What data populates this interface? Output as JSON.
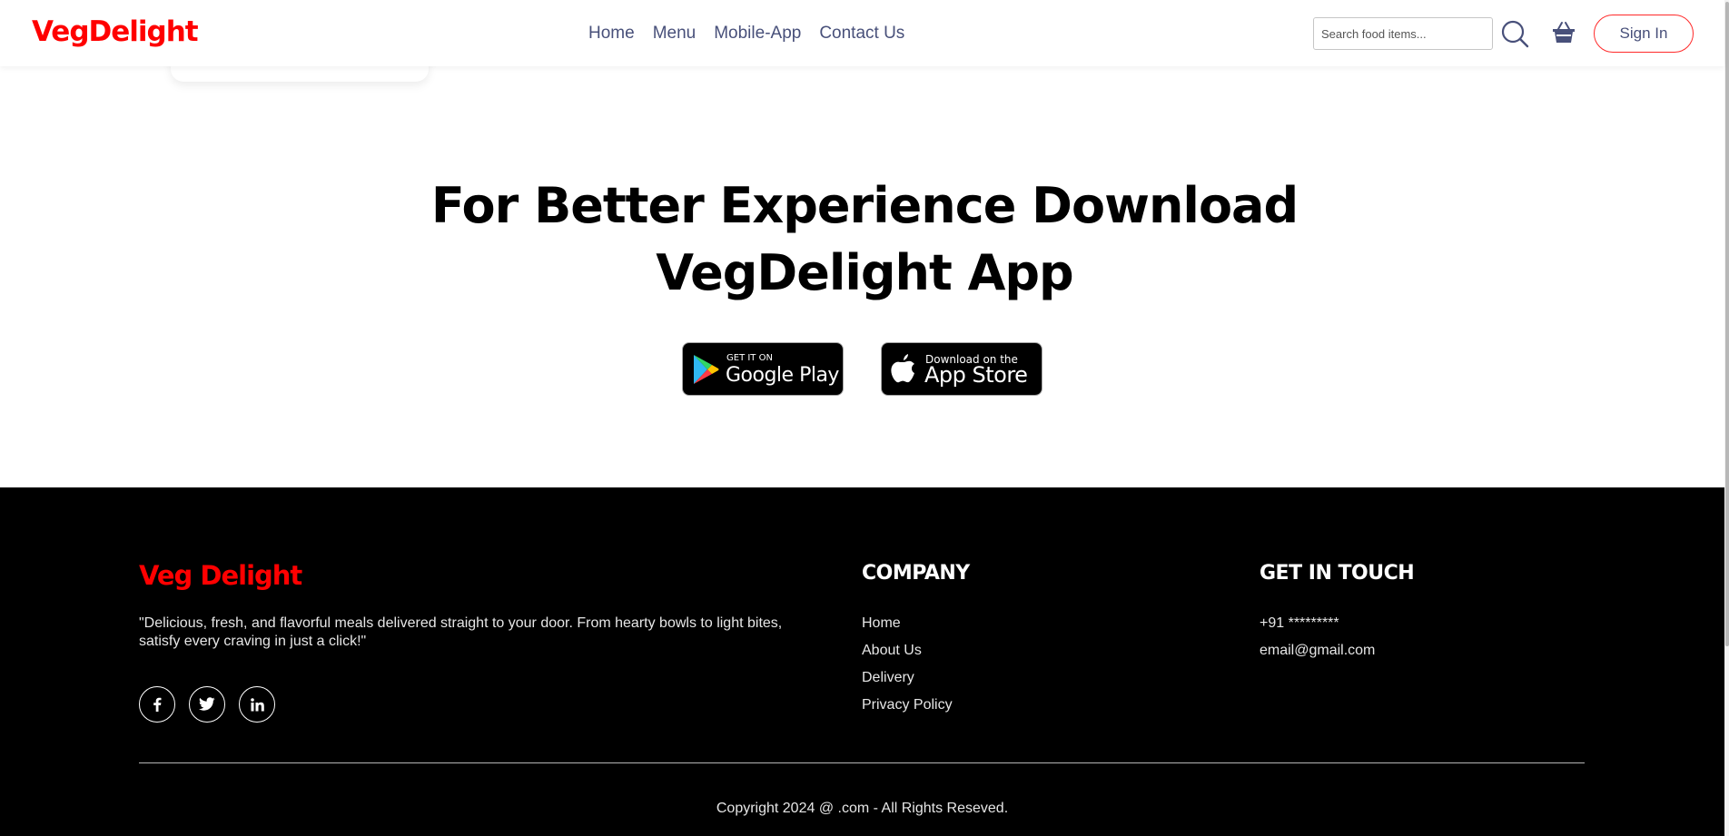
{
  "header": {
    "logo": "VegDelight",
    "nav": [
      "Home",
      "Menu",
      "Mobile-App",
      "Contact Us"
    ],
    "search_placeholder": "Search food items...",
    "signin_label": "Sign In"
  },
  "download": {
    "title_line1": "For Better Experience Download",
    "title_line2": "VegDelight App",
    "google_play": {
      "small": "GET IT ON",
      "big": "Google Play"
    },
    "app_store": {
      "small": "Download on the",
      "big": "App Store"
    }
  },
  "footer": {
    "logo": "Veg Delight",
    "description": "\"Delicious, fresh, and flavorful meals delivered straight to your door. From hearty bowls to light bites, satisfy every craving in just a click!\"",
    "social_icons": [
      "facebook-icon",
      "twitter-icon",
      "linkedin-icon"
    ],
    "company": {
      "heading": "COMPANY",
      "links": [
        "Home",
        "About Us",
        "Delivery",
        "Privacy Policy"
      ]
    },
    "touch": {
      "heading": "GET IN TOUCH",
      "phone": "+91 *********",
      "email": "email@gmail.com"
    },
    "copyright": "Copyright 2024 @ .com - All Rights Reseved."
  },
  "colors": {
    "brand_red": "#ff0000",
    "nav_text": "#48507a",
    "footer_bg": "#000000"
  }
}
